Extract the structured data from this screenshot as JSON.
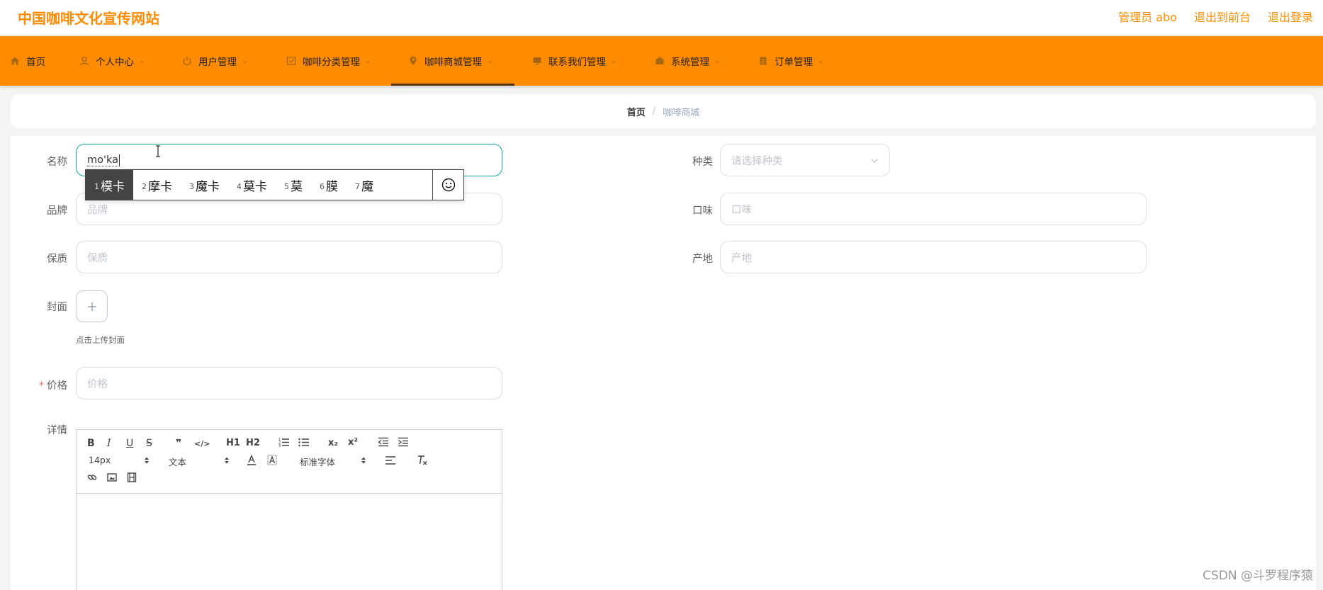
{
  "header": {
    "brand": "中国咖啡文化宣传网站",
    "admin_label": "管理员 abo",
    "to_front": "退出到前台",
    "logout": "退出登录"
  },
  "nav": {
    "items": [
      {
        "label": "首页",
        "icon": "home-icon",
        "has_dropdown": false
      },
      {
        "label": "个人中心",
        "icon": "user-icon",
        "has_dropdown": true
      },
      {
        "label": "用户管理",
        "icon": "power-icon",
        "has_dropdown": true
      },
      {
        "label": "咖啡分类管理",
        "icon": "check-square-icon",
        "has_dropdown": true
      },
      {
        "label": "咖啡商城管理",
        "icon": "location-pin-icon",
        "has_dropdown": true,
        "active": true
      },
      {
        "label": "联系我们管理",
        "icon": "monitor-icon",
        "has_dropdown": true
      },
      {
        "label": "系统管理",
        "icon": "briefcase-icon",
        "has_dropdown": true
      },
      {
        "label": "订单管理",
        "icon": "document-icon",
        "has_dropdown": true
      }
    ]
  },
  "breadcrumb": {
    "home": "首页",
    "separator": "/",
    "current": "咖啡商城"
  },
  "form": {
    "name": {
      "label": "名称",
      "value": "mo'ka"
    },
    "category": {
      "label": "种类",
      "placeholder": "请选择种类"
    },
    "brand": {
      "label": "品牌",
      "placeholder": "品牌"
    },
    "taste": {
      "label": "口味",
      "placeholder": "口味"
    },
    "shelf_life": {
      "label": "保质",
      "placeholder": "保质"
    },
    "origin": {
      "label": "产地",
      "placeholder": "产地"
    },
    "cover": {
      "label": "封面",
      "tip": "点击上传封面"
    },
    "price": {
      "label": "价格",
      "placeholder": "价格",
      "required_mark": "*"
    },
    "detail": {
      "label": "详情"
    }
  },
  "ime": {
    "candidates": [
      {
        "num": "1",
        "text": "模卡"
      },
      {
        "num": "2",
        "text": "摩卡"
      },
      {
        "num": "3",
        "text": "魔卡"
      },
      {
        "num": "4",
        "text": "莫卡"
      },
      {
        "num": "5",
        "text": "莫"
      },
      {
        "num": "6",
        "text": "膜"
      },
      {
        "num": "7",
        "text": "魔"
      }
    ],
    "selected_index": 0
  },
  "editor": {
    "font_size": "14px",
    "header_select": "文本",
    "font_family": "标准字体",
    "buttons": {
      "bold": "B",
      "italic": "I",
      "underline": "U",
      "strike": "S",
      "quote": "❞",
      "code": "</>",
      "h1": "H1",
      "h2": "H2",
      "subscript": "x₂",
      "superscript": "x²"
    }
  },
  "watermark": "CSDN @斗罗程序猿",
  "colors": {
    "accent": "#ff8c00",
    "focus": "#12a594",
    "required": "#f56c6c"
  }
}
